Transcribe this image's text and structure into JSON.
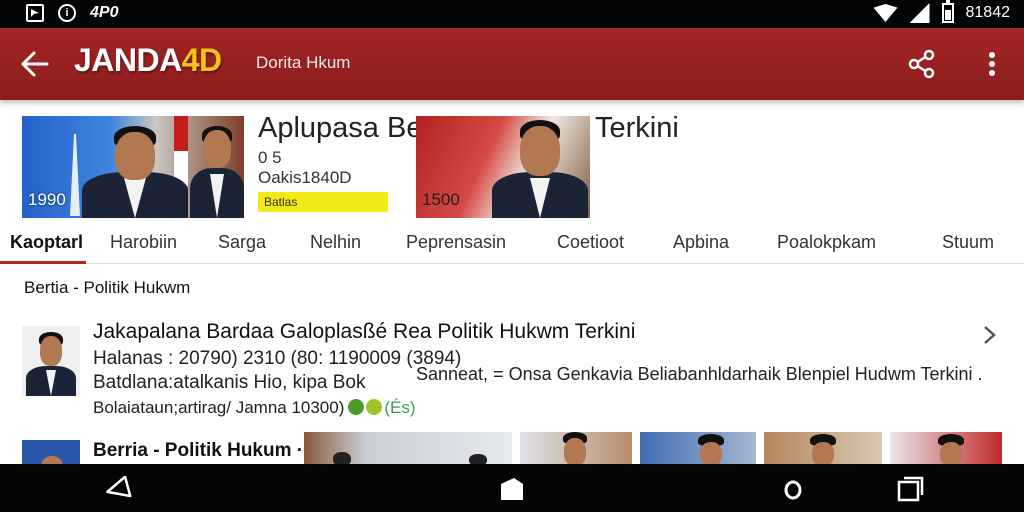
{
  "statusbar": {
    "left_text": "4P0",
    "time": "81842"
  },
  "appbar": {
    "logo_main": "JANDA",
    "logo_accent": "4D",
    "subtitle": "Dorita Hkum",
    "accent_color": "#f2c318",
    "bar_color": "#9d2322"
  },
  "hero": {
    "thumb_a_num": "1990",
    "thumb_b_num": "1500",
    "title_part1": "Aplupasa Berbolik",
    "title_part2": "Terkini",
    "sub1": "0   5",
    "sub2": "Oakis1840D",
    "badge": "Batlas"
  },
  "tabs": [
    {
      "label": "Kaoptarl",
      "active": true
    },
    {
      "label": "Harobiin"
    },
    {
      "label": "Sarga"
    },
    {
      "label": "Nelhin"
    },
    {
      "label": "Peprensasin"
    },
    {
      "label": "Coetioot"
    },
    {
      "label": "Apbina"
    },
    {
      "label": "Poalokpkam"
    },
    {
      "label": "Stuum"
    }
  ],
  "section": {
    "title": "Bertia - Politik Hukwm"
  },
  "item1": {
    "title": "Jakapalana Bardaa Galoplasßé Rea Politik Hukwm Terkini",
    "meta": "Halanas : 20790) 2310 (80: 1190009 (3894)",
    "desc1": "Batdlana:atalkanis Hio, kipa Bok",
    "desc2": "Bolaiataun;artirag/ Jamna 10300)",
    "paren": "(És)",
    "side": "Sanneat, = Onsa Genkavia Beliabanhldarhaik Blenpiel Hudwm Terkini ."
  },
  "item2": {
    "title": "Berria - Politik Hukum ·"
  },
  "icons": {
    "back": "arrow-back-icon",
    "share": "share-icon",
    "more": "more-vert-icon",
    "chevron": "chevron-right-icon",
    "nav_back": "nav-back-icon",
    "nav_home": "nav-home-icon",
    "nav_circle": "nav-circle-icon",
    "nav_recents": "nav-recents-icon"
  }
}
